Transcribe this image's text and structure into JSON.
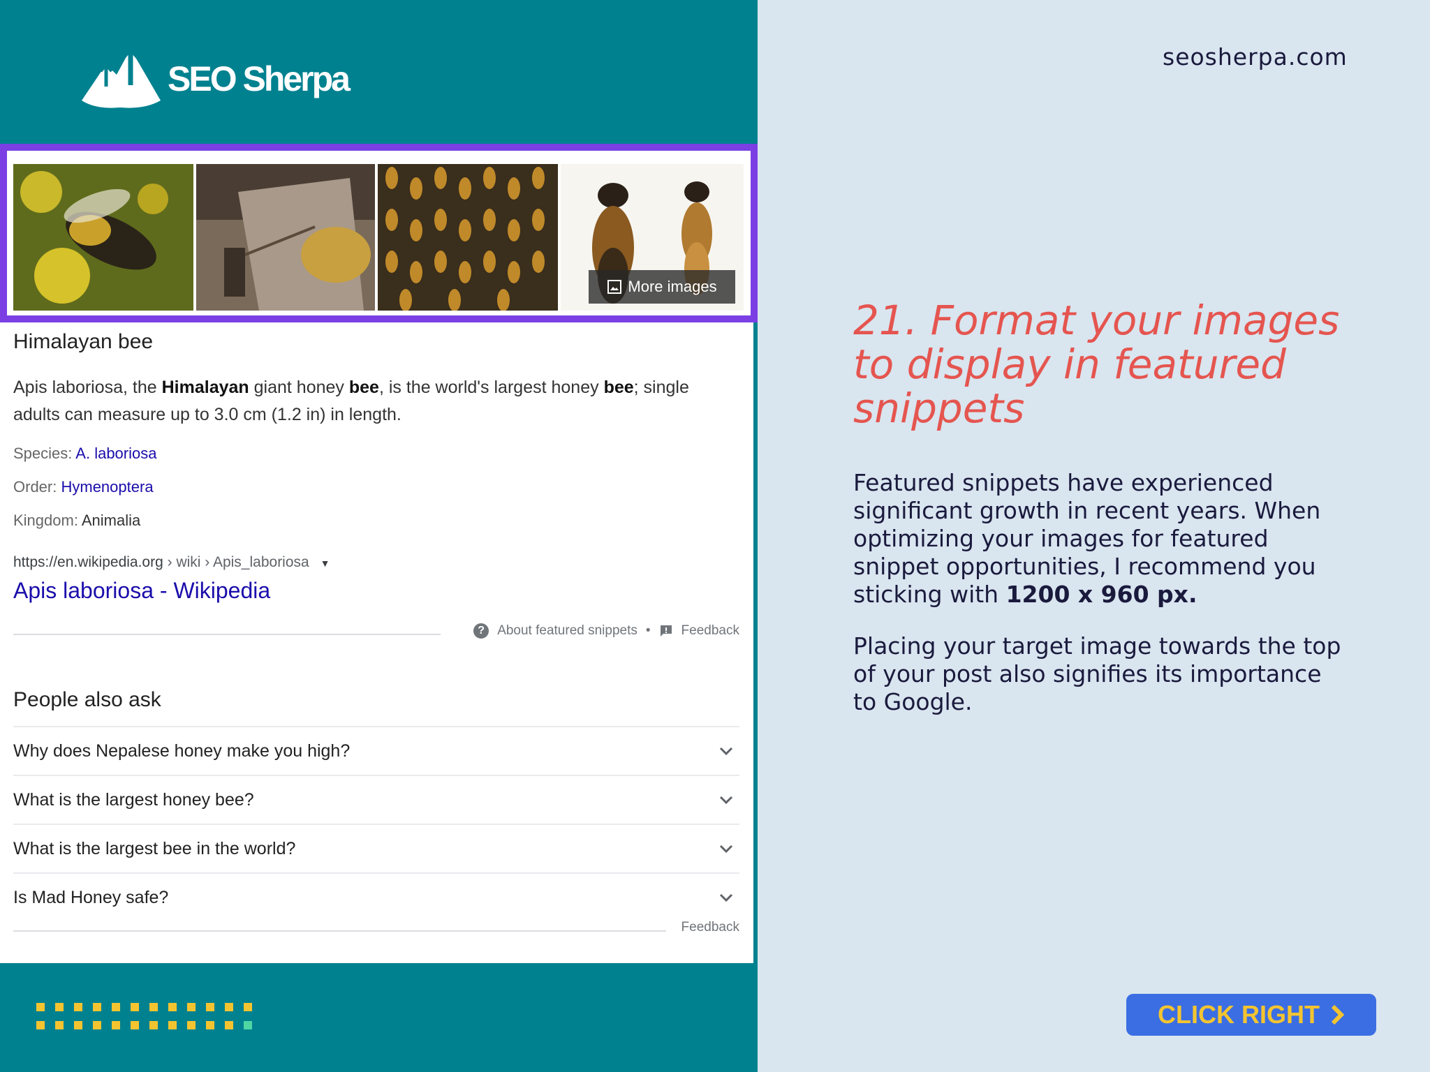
{
  "brand": {
    "name": "SEO Sherpa",
    "url": "seosherpa.com"
  },
  "serp": {
    "more_images_label": "More images",
    "entity_title": "Himalayan bee",
    "desc_parts": [
      "Apis laboriosa, the ",
      "Himalayan",
      " giant honey ",
      "bee",
      ", is the world's largest honey ",
      "bee",
      "; single adults can measure up to 3.0 cm (1.2 in) in length."
    ],
    "facts": [
      {
        "label": "Species:",
        "value": "A. laboriosa"
      },
      {
        "label": "Order:",
        "value": "Hymenoptera"
      },
      {
        "label": "Kingdom:",
        "value": "Animalia"
      }
    ],
    "cite_domain": "https://en.wikipedia.org",
    "cite_path": " › wiki › Apis_laboriosa",
    "result_title": "Apis laboriosa - Wikipedia",
    "about_snippets": "About featured snippets",
    "feedback": "Feedback",
    "paa_title": "People also ask",
    "paa_questions": [
      "Why does Nepalese honey make you high?",
      "What is the largest honey bee?",
      "What is the largest bee in the world?",
      "Is Mad Honey safe?"
    ]
  },
  "slide": {
    "headline": "21. Format your images to display in featured snippets",
    "para1_text": "Featured snippets have experienced significant growth in recent years. When optimizing your images for featured snippet opportunities, I recommend you sticking with ",
    "para1_bold": "1200 x 960 px.",
    "para2": "Placing your target image towards the top of your post also signifies its importance to Google.",
    "cta": "CLICK RIGHT"
  },
  "colors": {
    "teal": "#00818f",
    "accent_red": "#e5554f",
    "purple_border": "#7b3fe4",
    "cta_bg": "#3b6ee3",
    "cta_text": "#f4c430",
    "link_blue": "#1a0dab"
  }
}
